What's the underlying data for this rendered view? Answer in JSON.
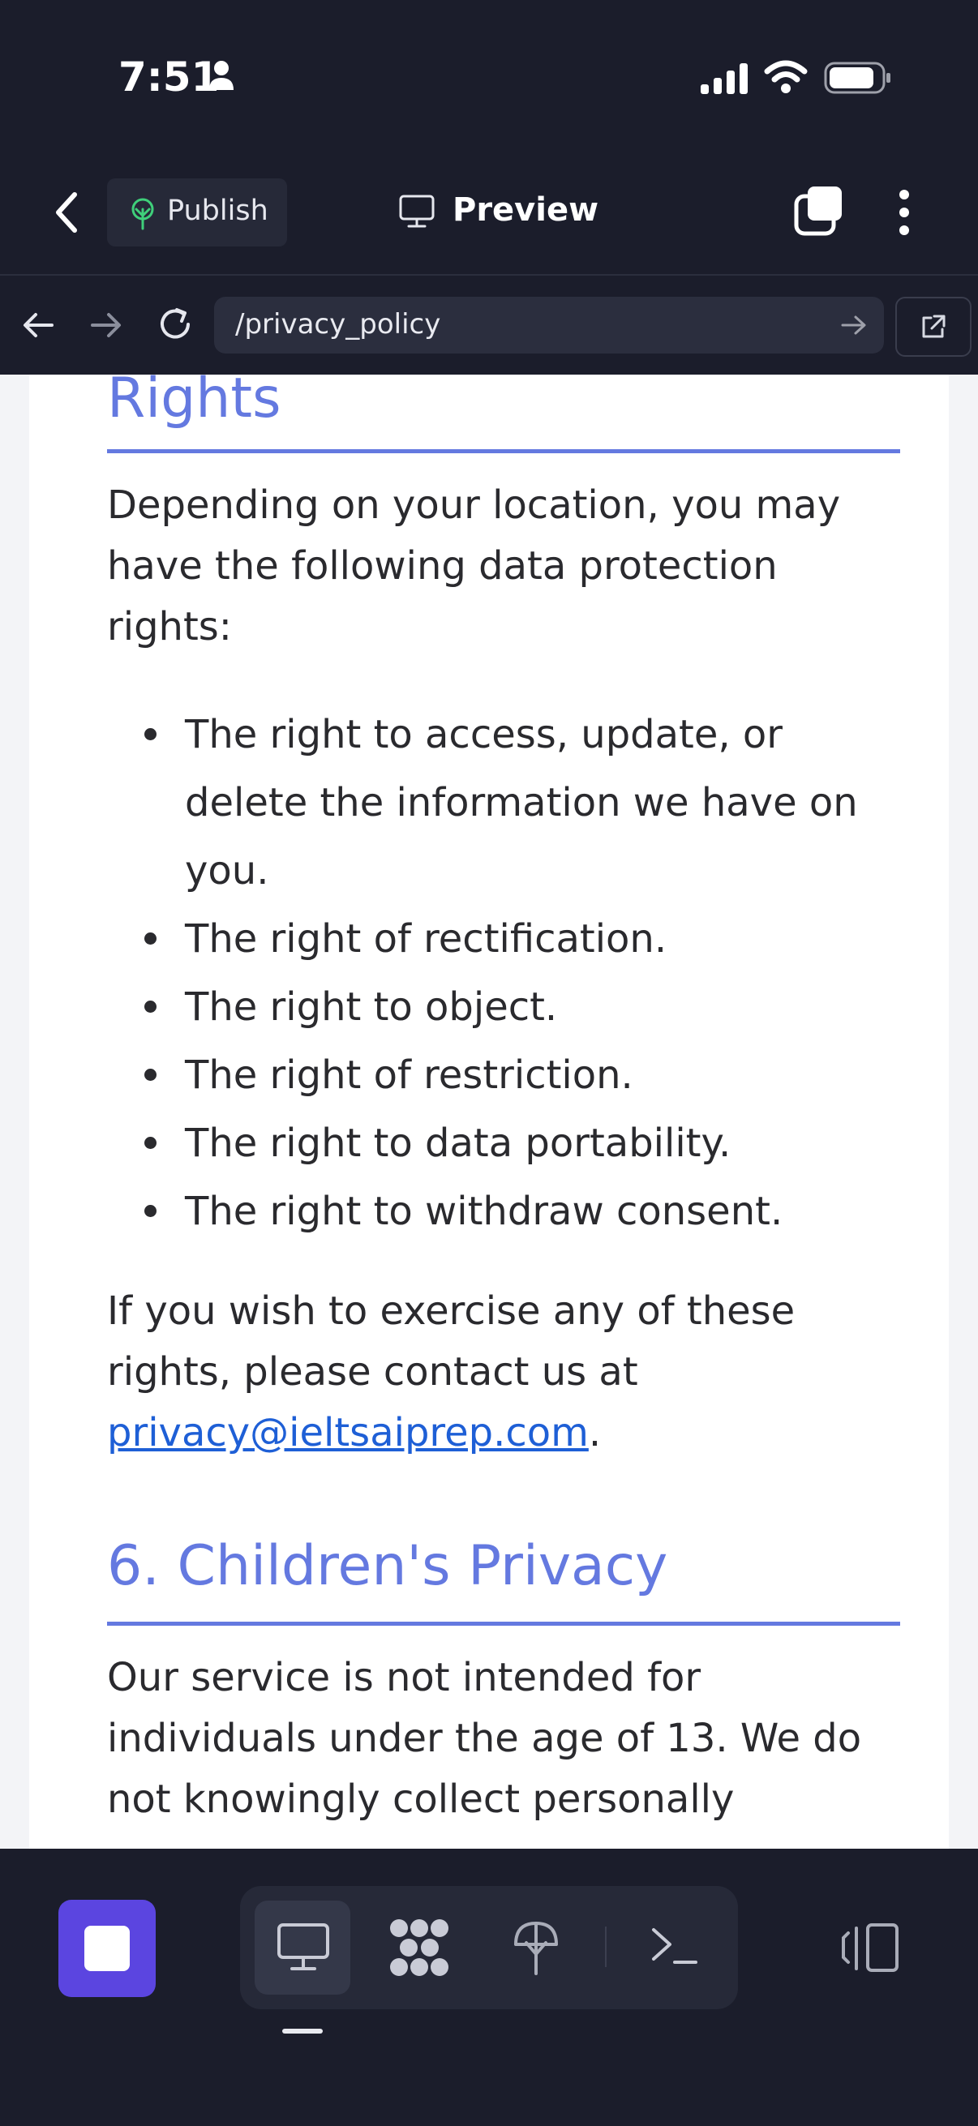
{
  "status_bar": {
    "time": "7:51"
  },
  "header": {
    "publish_label": "Publish",
    "preview_label": "Preview"
  },
  "browser": {
    "url": "/privacy_policy"
  },
  "article": {
    "section5_heading_tail": "Rights",
    "section5_intro": "Depending on your location, you may have the following data protection rights:",
    "rights": [
      {
        "line1": "The right to access, update, or",
        "line2": "delete the information we have on",
        "line3": "you."
      },
      {
        "line1": "The right of rectification."
      },
      {
        "line1": "The right to object."
      },
      {
        "line1": "The right of restriction."
      },
      {
        "line1": "The right to data portability."
      },
      {
        "line1": "The right to withdraw consent."
      }
    ],
    "contact_line1": "If you wish to exercise any of these",
    "contact_line2": "rights, please contact us at",
    "contact_email": "privacy@ieltsaiprep.com",
    "contact_period": ".",
    "section6_heading": "6. Children's Privacy",
    "section6_line1": "Our service is not intended for",
    "section6_line2": "individuals under the age of 13. We do",
    "section6_line3": "not knowingly collect personally"
  },
  "colors": {
    "accent": "#6479e0",
    "link": "#1e5fd6",
    "chrome": "#1b1d2b",
    "stop": "#5b45e0"
  }
}
